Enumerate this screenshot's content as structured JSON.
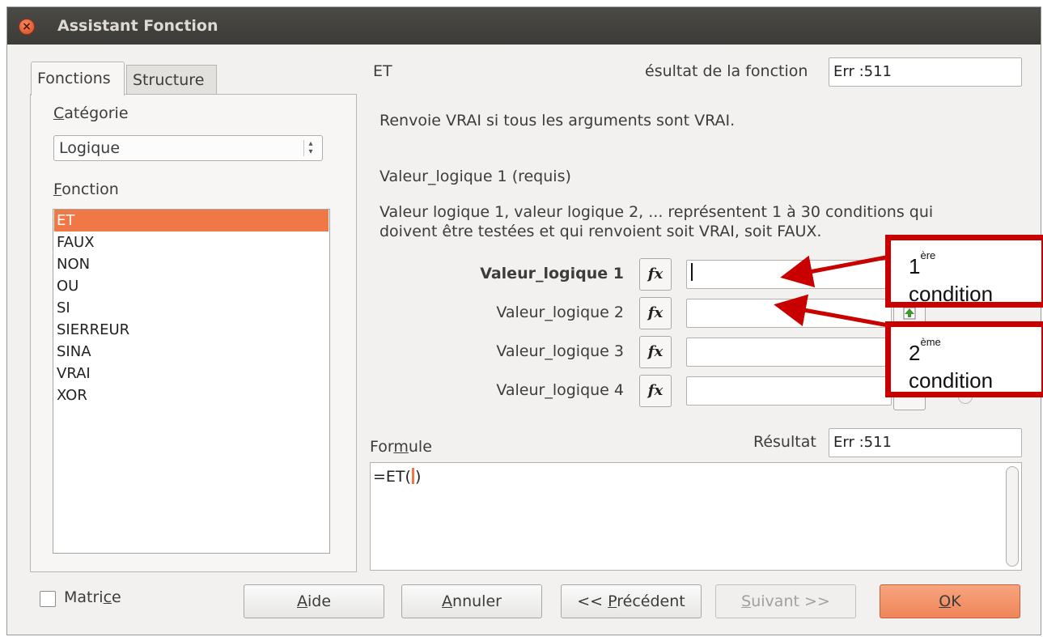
{
  "window": {
    "title": "Assistant Fonction"
  },
  "tabs": [
    {
      "label": "Fonctions"
    },
    {
      "label": "Structure"
    }
  ],
  "left": {
    "category_label_u": "C",
    "category_label_rest": "atégorie",
    "category_value": "Logique",
    "function_label_u": "F",
    "function_label_rest": "onction",
    "functions": [
      "ET",
      "FAUX",
      "NON",
      "OU",
      "SI",
      "SIERREUR",
      "SINA",
      "VRAI",
      "XOR"
    ],
    "selected_function": "ET"
  },
  "right": {
    "function_name": "ET",
    "result_label": "ésultat de la fonction",
    "result_value": "Err :511",
    "description": "Renvoie VRAI si tous les arguments sont VRAI.",
    "arg_title": "Valeur_logique 1 (requis)",
    "arg_desc_line1": "Valeur logique 1, valeur logique 2, ... représentent 1 à 30 conditions qui",
    "arg_desc_line2": "doivent être testées et qui renvoient soit VRAI, soit FAUX.",
    "args": [
      {
        "label": "Valeur_logique 1",
        "value": ""
      },
      {
        "label": "Valeur_logique 2",
        "value": ""
      },
      {
        "label": "Valeur_logique 3",
        "value": ""
      },
      {
        "label": "Valeur_logique 4",
        "value": ""
      }
    ],
    "fx_label": "fx",
    "formula_label_a": "For",
    "formula_label_u": "m",
    "formula_label_b": "ule",
    "formula_result_label": "Résultat",
    "formula_result_value": "Err :511",
    "formula_before": "=ET(",
    "formula_after": ")"
  },
  "footer": {
    "matrix_a": "Matri",
    "matrix_u": "c",
    "matrix_b": "e",
    "help_u": "A",
    "help_rest": "ide",
    "cancel_u": "A",
    "cancel_rest": "nnuler",
    "prev_a": "<< ",
    "prev_u": "P",
    "prev_rest": "récédent",
    "next_u": "S",
    "next_rest": "uivant >>",
    "ok_u": "O",
    "ok_rest": "K"
  },
  "callouts": [
    {
      "number": "1",
      "sup": "ère",
      "word": "condition"
    },
    {
      "number": "2",
      "sup": "ème",
      "word": "condition"
    }
  ],
  "colors": {
    "accent": "#f07746",
    "annotation": "#c90000",
    "titlebar": "#3c3b37"
  }
}
